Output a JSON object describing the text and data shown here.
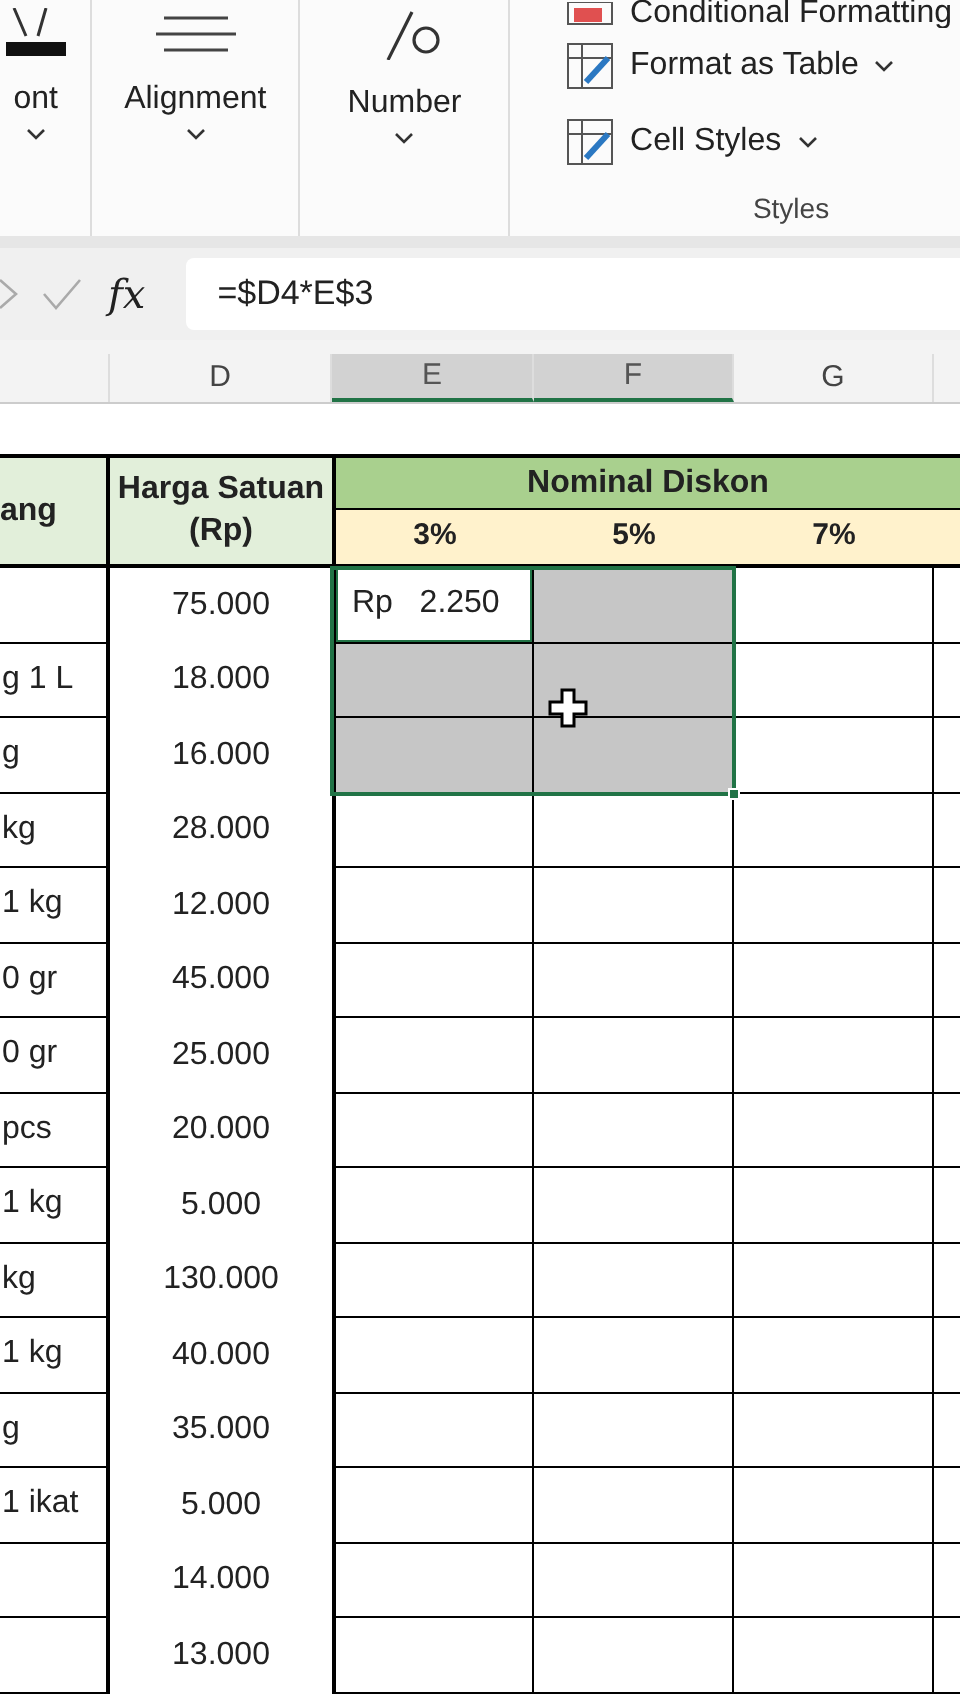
{
  "ribbon": {
    "groups": [
      {
        "kind": "font",
        "label": "ont"
      },
      {
        "kind": "alignment",
        "label": "Alignment"
      },
      {
        "kind": "number",
        "label": "Number"
      }
    ],
    "styles": {
      "label": "Styles",
      "items": [
        {
          "kind": "conditional",
          "label": "Conditional Formatting"
        },
        {
          "kind": "table",
          "label": "Format as Table"
        },
        {
          "kind": "cellstyles",
          "label": "Cell Styles"
        }
      ]
    }
  },
  "formula_bar": {
    "fx": "fx",
    "formula": "=$D4*E$3"
  },
  "column_headers": [
    {
      "label": "D",
      "selected": false
    },
    {
      "label": "E",
      "selected": true
    },
    {
      "label": "F",
      "selected": true
    },
    {
      "label": "G",
      "selected": false
    }
  ],
  "table_header": {
    "column_c": "ang",
    "price": "Harga Satuan (Rp)",
    "group": "Nominal Diskon",
    "rates": [
      "3%",
      "5%",
      "7%"
    ]
  },
  "rows": [
    {
      "price": "75.000",
      "discounts": [
        {
          "text": "Rp   2.250",
          "selected": true,
          "active": true
        },
        {
          "selected": true,
          "active": false
        },
        {
          "selected": false,
          "active": false
        }
      ]
    },
    {
      "item": "g 1 L",
      "price": "18.000",
      "discounts": [
        {
          "selected": true,
          "active": false
        },
        {
          "selected": true,
          "active": false
        },
        {
          "selected": false,
          "active": false
        }
      ]
    },
    {
      "item": "g",
      "price": "16.000",
      "discounts": [
        {
          "selected": true,
          "active": false
        },
        {
          "selected": true,
          "active": false
        },
        {
          "selected": false,
          "active": false
        }
      ]
    },
    {
      "item": "kg",
      "price": "28.000",
      "discounts": [
        {
          "selected": false,
          "active": false
        },
        {
          "selected": false,
          "active": false
        },
        {
          "selected": false,
          "active": false
        }
      ]
    },
    {
      "item": "1 kg",
      "price": "12.000",
      "discounts": [
        {
          "selected": false,
          "active": false
        },
        {
          "selected": false,
          "active": false
        },
        {
          "selected": false,
          "active": false
        }
      ]
    },
    {
      "item": "0 gr",
      "price": "45.000",
      "discounts": [
        {
          "selected": false,
          "active": false
        },
        {
          "selected": false,
          "active": false
        },
        {
          "selected": false,
          "active": false
        }
      ]
    },
    {
      "item": "0 gr",
      "price": "25.000",
      "discounts": [
        {
          "selected": false,
          "active": false
        },
        {
          "selected": false,
          "active": false
        },
        {
          "selected": false,
          "active": false
        }
      ]
    },
    {
      "item": "pcs",
      "price": "20.000",
      "discounts": [
        {
          "selected": false,
          "active": false
        },
        {
          "selected": false,
          "active": false
        },
        {
          "selected": false,
          "active": false
        }
      ]
    },
    {
      "item": "1 kg",
      "price": "5.000",
      "discounts": [
        {
          "selected": false,
          "active": false
        },
        {
          "selected": false,
          "active": false
        },
        {
          "selected": false,
          "active": false
        }
      ]
    },
    {
      "item": "kg",
      "price": "130.000",
      "discounts": [
        {
          "selected": false,
          "active": false
        },
        {
          "selected": false,
          "active": false
        },
        {
          "selected": false,
          "active": false
        }
      ]
    },
    {
      "item": "1 kg",
      "price": "40.000",
      "discounts": [
        {
          "selected": false,
          "active": false
        },
        {
          "selected": false,
          "active": false
        },
        {
          "selected": false,
          "active": false
        }
      ]
    },
    {
      "item": "g",
      "price": "35.000",
      "discounts": [
        {
          "selected": false,
          "active": false
        },
        {
          "selected": false,
          "active": false
        },
        {
          "selected": false,
          "active": false
        }
      ]
    },
    {
      "item": "1 ikat",
      "price": "5.000",
      "discounts": [
        {
          "selected": false,
          "active": false
        },
        {
          "selected": false,
          "active": false
        },
        {
          "selected": false,
          "active": false
        }
      ]
    },
    {
      "price": "14.000",
      "discounts": [
        {
          "selected": false,
          "active": false
        },
        {
          "selected": false,
          "active": false
        },
        {
          "selected": false,
          "active": false
        }
      ]
    },
    {
      "price": "13.000",
      "discounts": [
        {
          "selected": false,
          "active": false
        },
        {
          "selected": false,
          "active": false
        },
        {
          "selected": false,
          "active": false
        }
      ]
    }
  ]
}
